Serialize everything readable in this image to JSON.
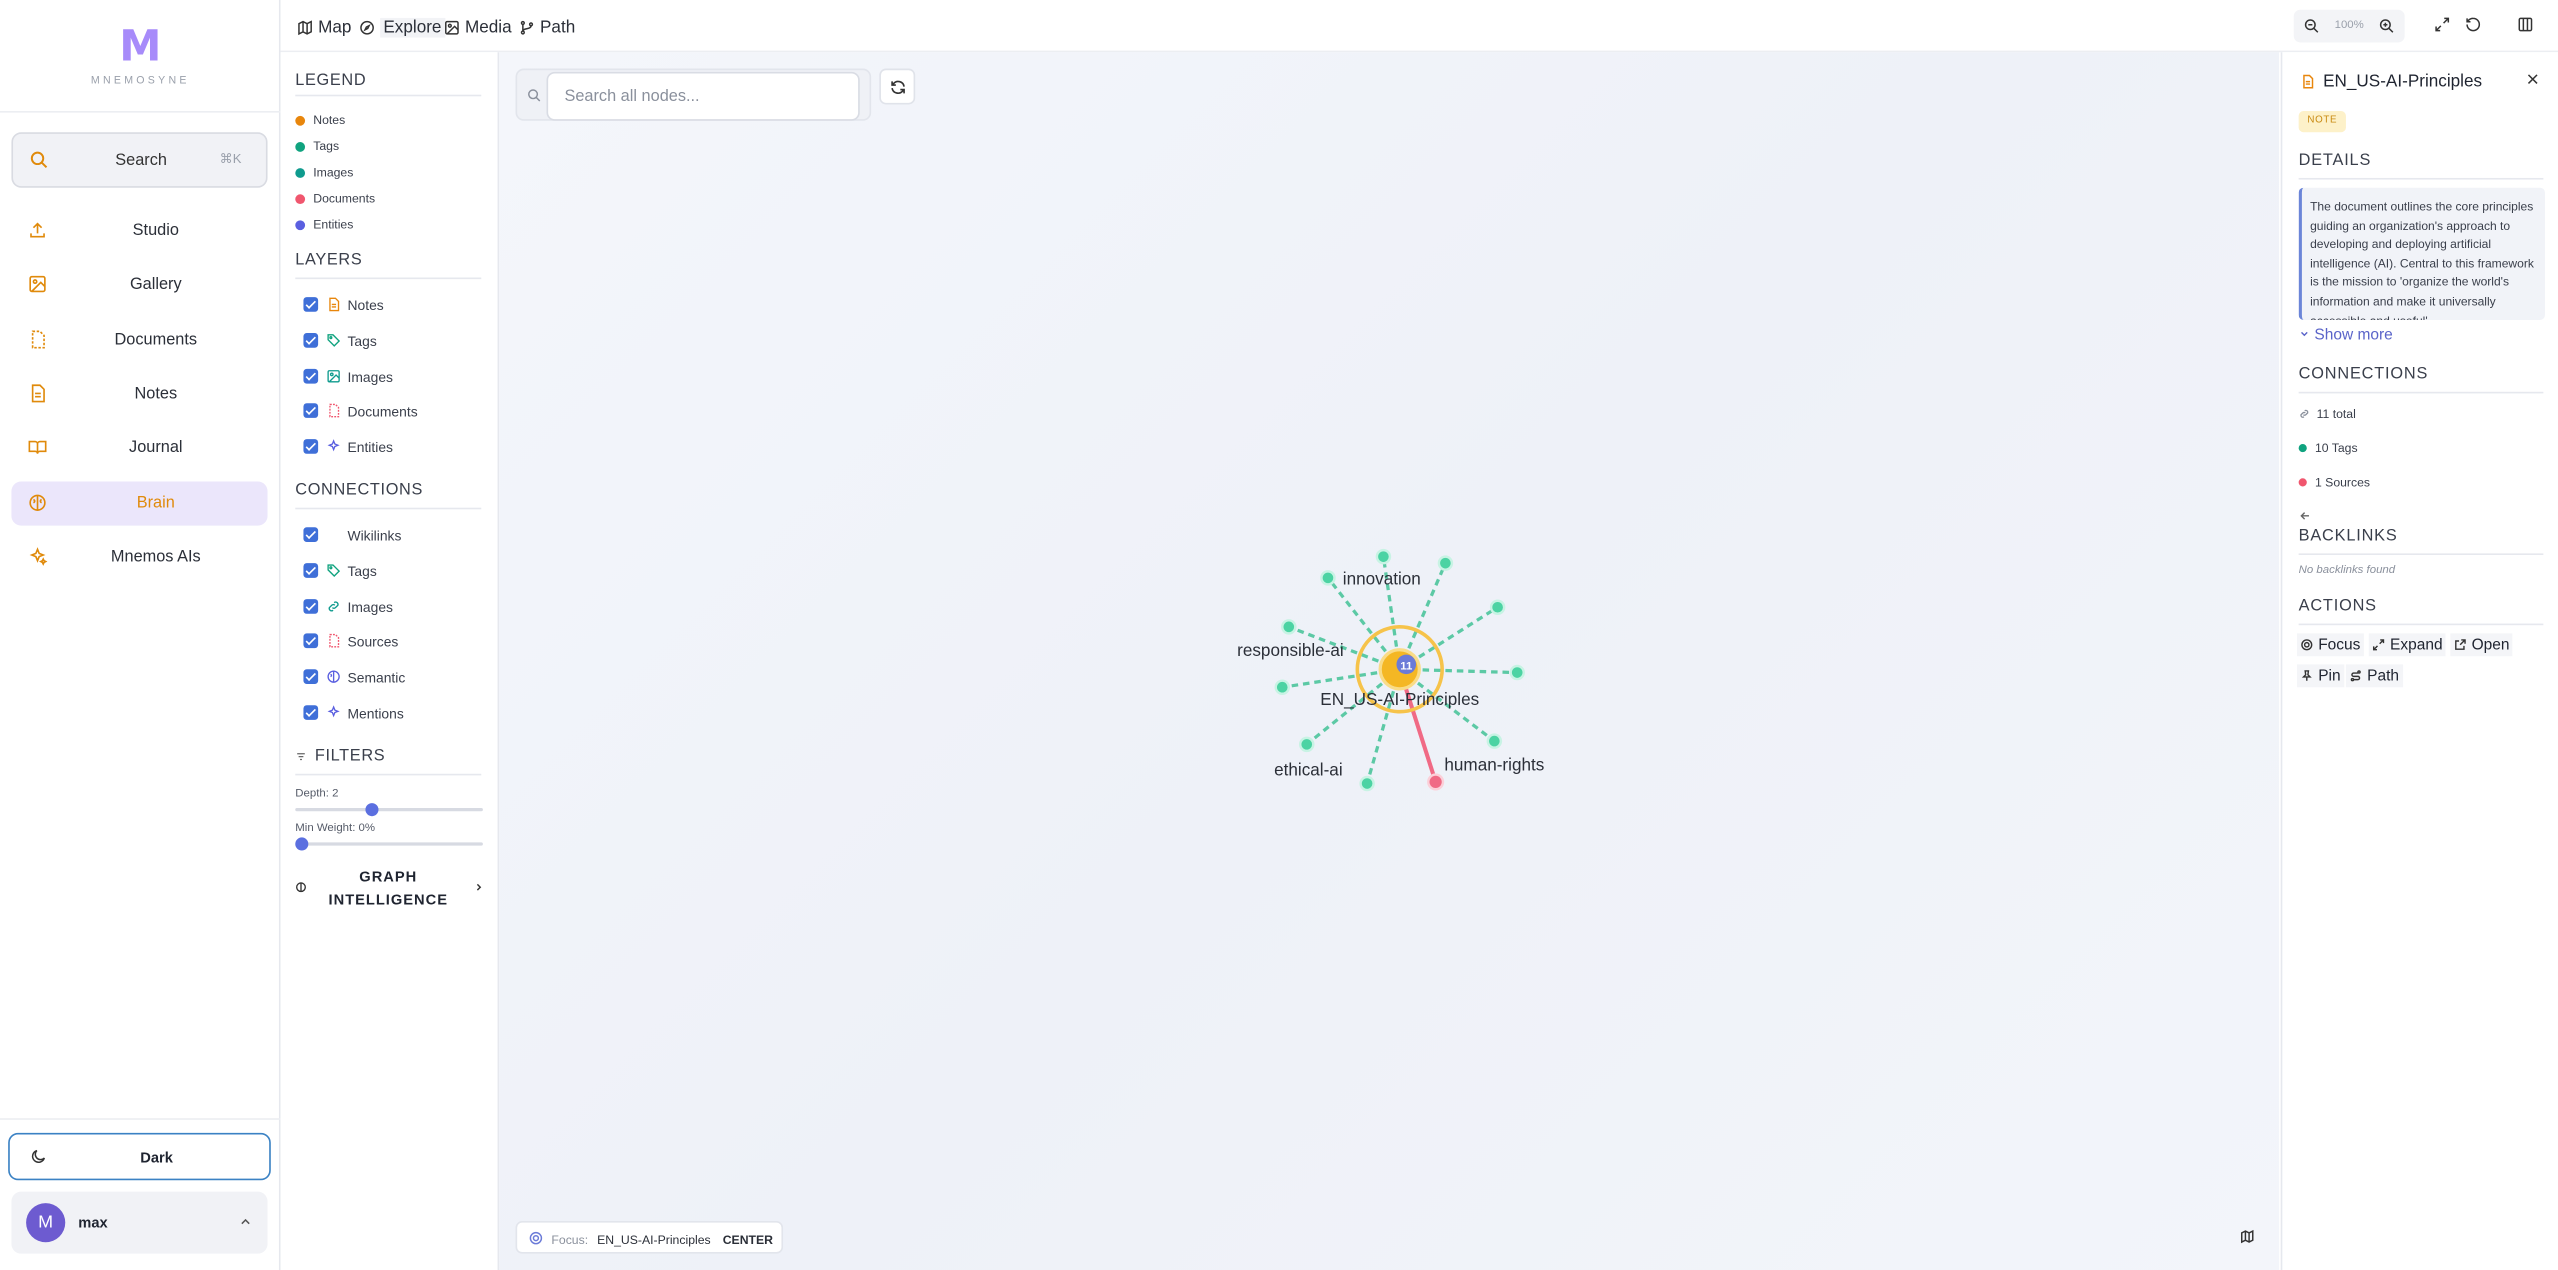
{
  "app": {
    "logo_letter": "M",
    "logo_name": "MNEMOSYNE"
  },
  "sidebar": {
    "search_label": "Search",
    "search_shortcut": "⌘K",
    "items": [
      {
        "label": "Studio",
        "icon": "upload-icon"
      },
      {
        "label": "Gallery",
        "icon": "image-icon"
      },
      {
        "label": "Documents",
        "icon": "document-icon"
      },
      {
        "label": "Notes",
        "icon": "note-icon"
      },
      {
        "label": "Journal",
        "icon": "book-icon"
      },
      {
        "label": "Brain",
        "icon": "brain-icon",
        "active": true
      },
      {
        "label": "Mnemos AIs",
        "icon": "sparkles-icon"
      }
    ],
    "theme_label": "Dark",
    "user": {
      "initial": "M",
      "name": "max"
    }
  },
  "topbar": {
    "tabs": [
      {
        "label": "Map",
        "icon": "map-icon"
      },
      {
        "label": "Explore",
        "icon": "compass-icon",
        "active": true
      },
      {
        "label": "Media",
        "icon": "image-icon"
      },
      {
        "label": "Path",
        "icon": "branch-icon"
      }
    ],
    "zoom": "100%"
  },
  "panel": {
    "legend_title": "LEGEND",
    "legend": [
      {
        "label": "Notes",
        "color": "#e8860c"
      },
      {
        "label": "Tags",
        "color": "#10a37f"
      },
      {
        "label": "Images",
        "color": "#0f9b8e"
      },
      {
        "label": "Documents",
        "color": "#f0566e"
      },
      {
        "label": "Entities",
        "color": "#5a5fe0"
      }
    ],
    "layers_title": "LAYERS",
    "layers": [
      {
        "label": "Notes",
        "icon": "note-icon",
        "checked": true
      },
      {
        "label": "Tags",
        "icon": "tag-icon",
        "checked": true
      },
      {
        "label": "Images",
        "icon": "image-icon",
        "checked": true
      },
      {
        "label": "Documents",
        "icon": "document-icon",
        "checked": true
      },
      {
        "label": "Entities",
        "icon": "sparkles-icon",
        "checked": true
      }
    ],
    "connections_title": "CONNECTIONS",
    "connections": [
      {
        "label": "Wikilinks",
        "icon": "",
        "checked": true
      },
      {
        "label": "Tags",
        "icon": "tag-icon",
        "checked": true
      },
      {
        "label": "Images",
        "icon": "link-icon",
        "checked": true
      },
      {
        "label": "Sources",
        "icon": "document-icon",
        "checked": true
      },
      {
        "label": "Semantic",
        "icon": "semantic-icon",
        "checked": true
      },
      {
        "label": "Mentions",
        "icon": "sparkles-icon",
        "checked": true
      }
    ],
    "filters_title": "FILTERS",
    "depth_label": "Depth: 2",
    "depth_value": 2,
    "depth_max": 5,
    "weight_label": "Min Weight: 0%",
    "weight_value": 0,
    "graph_intel_label": "GRAPH INTELLIGENCE"
  },
  "canvas": {
    "search_placeholder": "Search all nodes...",
    "center_node": {
      "label": "EN_US-AI-Principles",
      "count": "11"
    },
    "tag_labels": {
      "innovation": "innovation",
      "responsible": "responsible-ai",
      "ethical": "ethical-ai",
      "human": "human-rights"
    },
    "focus_key": "Focus:",
    "focus_value": "EN_US-AI-Principles",
    "focus_mode": "CENTER"
  },
  "details": {
    "title": "EN_US-AI-Principles",
    "type_badge": "NOTE",
    "details_title": "DETAILS",
    "description": "The document outlines the core principles guiding an organization's approach to developing and deploying artificial intelligence (AI). Central to this framework is the mission to 'organize the world's information and make it universally accessible and useful'.",
    "show_more": "Show more",
    "connections_title": "CONNECTIONS",
    "total": "11 total",
    "tags": "10 Tags",
    "sources": "1 Sources",
    "backlinks_title": "BACKLINKS",
    "no_backlinks": "No backlinks found",
    "actions_title": "ACTIONS",
    "actions": {
      "focus": "Focus",
      "expand": "Expand",
      "open": "Open",
      "pin": "Pin",
      "path": "Path"
    }
  },
  "colors": {
    "accent": "#e08a0b",
    "brand": "#a78bfa",
    "tag": "#4cc9a0",
    "source": "#f06a85",
    "center": "#f2b51c"
  }
}
